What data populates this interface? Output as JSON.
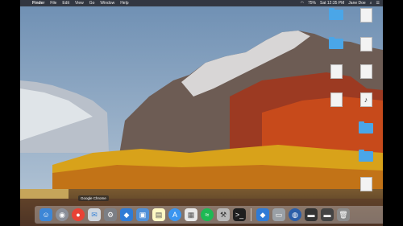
{
  "menubar": {
    "app": "Finder",
    "items": [
      "File",
      "Edit",
      "View",
      "Go",
      "Window",
      "Help"
    ],
    "status": {
      "battery": "75%",
      "datetime": "Sat 12:35 PM",
      "user": "Jane Doe"
    }
  },
  "desktop_icons": [
    {
      "label": "",
      "type": "folder"
    },
    {
      "label": "",
      "type": "doc"
    },
    {
      "label": "",
      "type": "folder"
    },
    {
      "label": "",
      "type": "doc"
    },
    {
      "label": "",
      "type": "doc"
    },
    {
      "label": "",
      "type": "doc"
    },
    {
      "label": "",
      "type": "doc"
    },
    {
      "label": "",
      "type": "music"
    },
    {
      "label": "",
      "type": "folder"
    },
    {
      "label": "",
      "type": "folder"
    },
    {
      "label": "",
      "type": "app"
    }
  ],
  "dock": {
    "tooltip": "Google Chrome",
    "apps": [
      "finder-icon",
      "safari-icon",
      "chrome-icon",
      "mail-icon",
      "settings-icon",
      "vscode-icon",
      "clients-icon",
      "notes-icon",
      "appstore-icon",
      "preview-icon",
      "spotify-icon",
      "tools-icon",
      "terminal-icon",
      "vscode-alt-icon",
      "disk-icon",
      "globe-icon",
      "screen-icon",
      "screen2-icon",
      "trash-icon"
    ]
  }
}
